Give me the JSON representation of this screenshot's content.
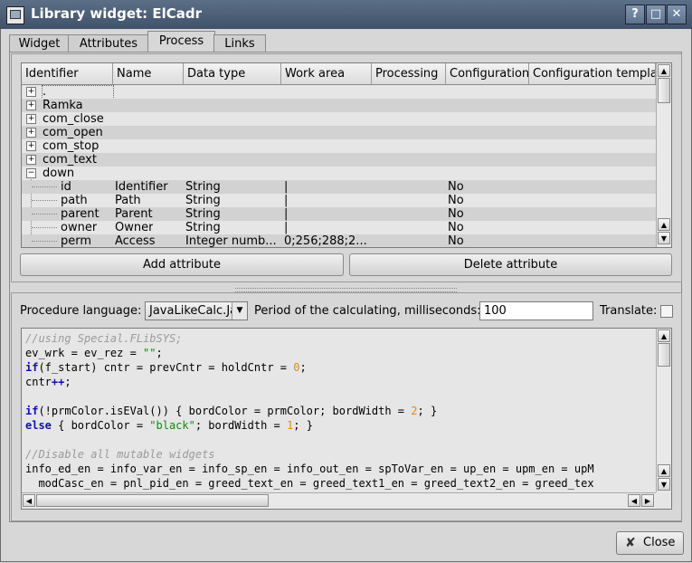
{
  "window": {
    "title": "Library widget: ElCadr"
  },
  "tabs": [
    {
      "label": "Widget"
    },
    {
      "label": "Attributes"
    },
    {
      "label": "Process"
    },
    {
      "label": "Links"
    }
  ],
  "tree": {
    "columns": [
      "Identifier",
      "Name",
      "Data type",
      "Work area",
      "Processing",
      "Configuration",
      "Configuration templa"
    ],
    "rows": [
      {
        "id": ".",
        "expander": "+"
      },
      {
        "id": "Ramka",
        "expander": "+"
      },
      {
        "id": "com_close",
        "expander": "+"
      },
      {
        "id": "com_open",
        "expander": "+"
      },
      {
        "id": "com_stop",
        "expander": "+"
      },
      {
        "id": "com_text",
        "expander": "+"
      },
      {
        "id": "down",
        "expander": "−"
      },
      {
        "id": "id",
        "name": "Identifier",
        "type": "String",
        "work": "|",
        "config": "No"
      },
      {
        "id": "path",
        "name": "Path",
        "type": "String",
        "work": "|",
        "config": "No"
      },
      {
        "id": "parent",
        "name": "Parent",
        "type": "String",
        "work": "|",
        "config": "No"
      },
      {
        "id": "owner",
        "name": "Owner",
        "type": "String",
        "work": "|",
        "config": "No"
      },
      {
        "id": "perm",
        "name": "Access",
        "type": "Integer numb...",
        "work": "0;256;288;2...",
        "config": "No"
      }
    ]
  },
  "buttons": {
    "add_attribute": "Add attribute",
    "delete_attribute": "Delete attribute",
    "close": "Close"
  },
  "procedure": {
    "language_label": "Procedure language:",
    "language_value": "JavaLikeCalc.Ja",
    "period_label": "Period of the calculating, milliseconds:",
    "period_value": "100",
    "translate_label": "Translate:"
  },
  "code_lines": [
    "//using Special.FLibSYS;",
    "ev_wrk = ev_rez = \"\";",
    "if(f_start) cntr = prevCntr = holdCntr = 0;",
    "cntr++;",
    "",
    "if(!prmColor.isEVal()) { bordColor = prmColor; bordWidth = 2; }",
    "else { bordColor = \"black\"; bordWidth = 1; }",
    "",
    "//Disable all mutable widgets",
    "info_ed_en = info_var_en = info_sp_en = info_out_en = spToVar_en = up_en = upm_en = upM",
    "  modCasc_en = pnl_pid_en = greed_text_en = greed_text1_en = greed_text2_en = greed_tex"
  ]
}
